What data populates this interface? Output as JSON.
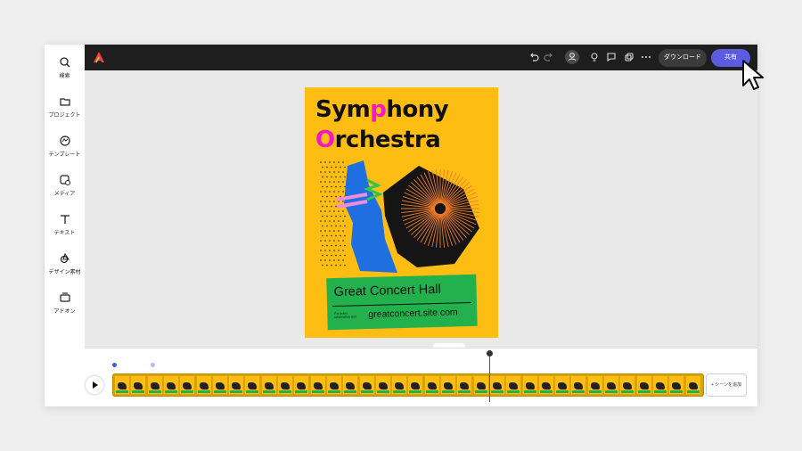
{
  "sidebar": {
    "items": [
      {
        "label": "検索",
        "icon": "search-icon"
      },
      {
        "label": "プロジェクト",
        "icon": "folder-icon"
      },
      {
        "label": "テンプレート",
        "icon": "template-icon"
      },
      {
        "label": "メディア",
        "icon": "media-icon"
      },
      {
        "label": "テキスト",
        "icon": "text-icon"
      },
      {
        "label": "デザイン素材",
        "icon": "design-assets-icon"
      },
      {
        "label": "アドオン",
        "icon": "addon-icon"
      }
    ]
  },
  "toolbar": {
    "download_label": "ダウンロード",
    "share_label": "共有",
    "icons": [
      "undo-icon",
      "redo-icon",
      "user-icon",
      "lightbulb-icon",
      "comment-icon",
      "duplicate-icon",
      "more-icon"
    ]
  },
  "poster": {
    "title_line1_a": "Sym",
    "title_line1_p": "p",
    "title_line1_b": "hony",
    "title_line2_o": "O",
    "title_line2_b": "rchestra",
    "venue": "Great Concert Hall",
    "small_text": "For ticket information visit",
    "url": "greatconcert.site.com"
  },
  "timeline": {
    "add_scene_label": "+ シーンを追加",
    "frame_count": 36
  },
  "colors": {
    "poster_bg": "#fdbd12",
    "accent_pink": "#f218c7",
    "accent_green": "#22b14c",
    "share_button": "#5c5ce0"
  }
}
